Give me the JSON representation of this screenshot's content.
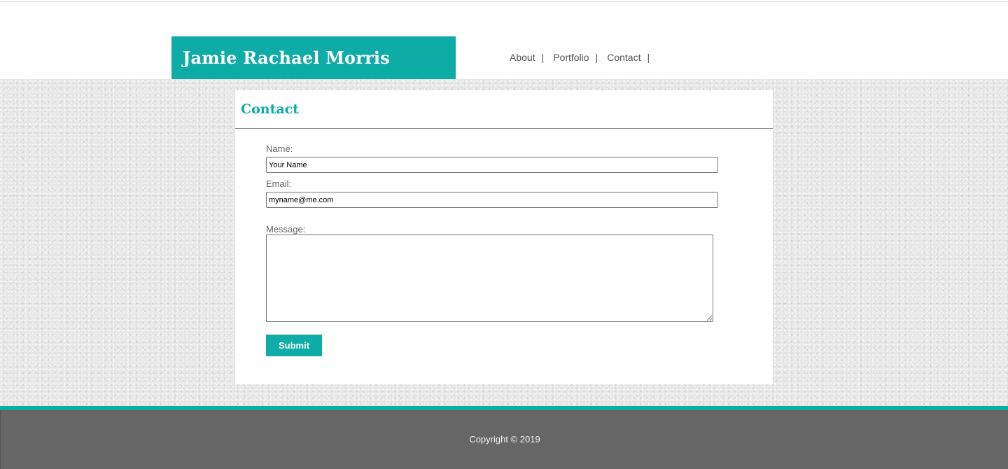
{
  "header": {
    "site_title": "Jamie Rachael Morris",
    "brand_color": "#0eaca6"
  },
  "nav": {
    "items": [
      {
        "label": "About"
      },
      {
        "label": "Portfolio"
      },
      {
        "label": "Contact"
      }
    ],
    "separator": "|"
  },
  "contact": {
    "heading": "Contact",
    "name_label": "Name:",
    "name_value": "Your Name",
    "email_label": "Email:",
    "email_value": "myname@me.com",
    "message_label": "Message:",
    "message_value": "",
    "submit_label": "Submit"
  },
  "footer": {
    "copyright": "Copyright © 2019",
    "background_color": "#666666"
  }
}
